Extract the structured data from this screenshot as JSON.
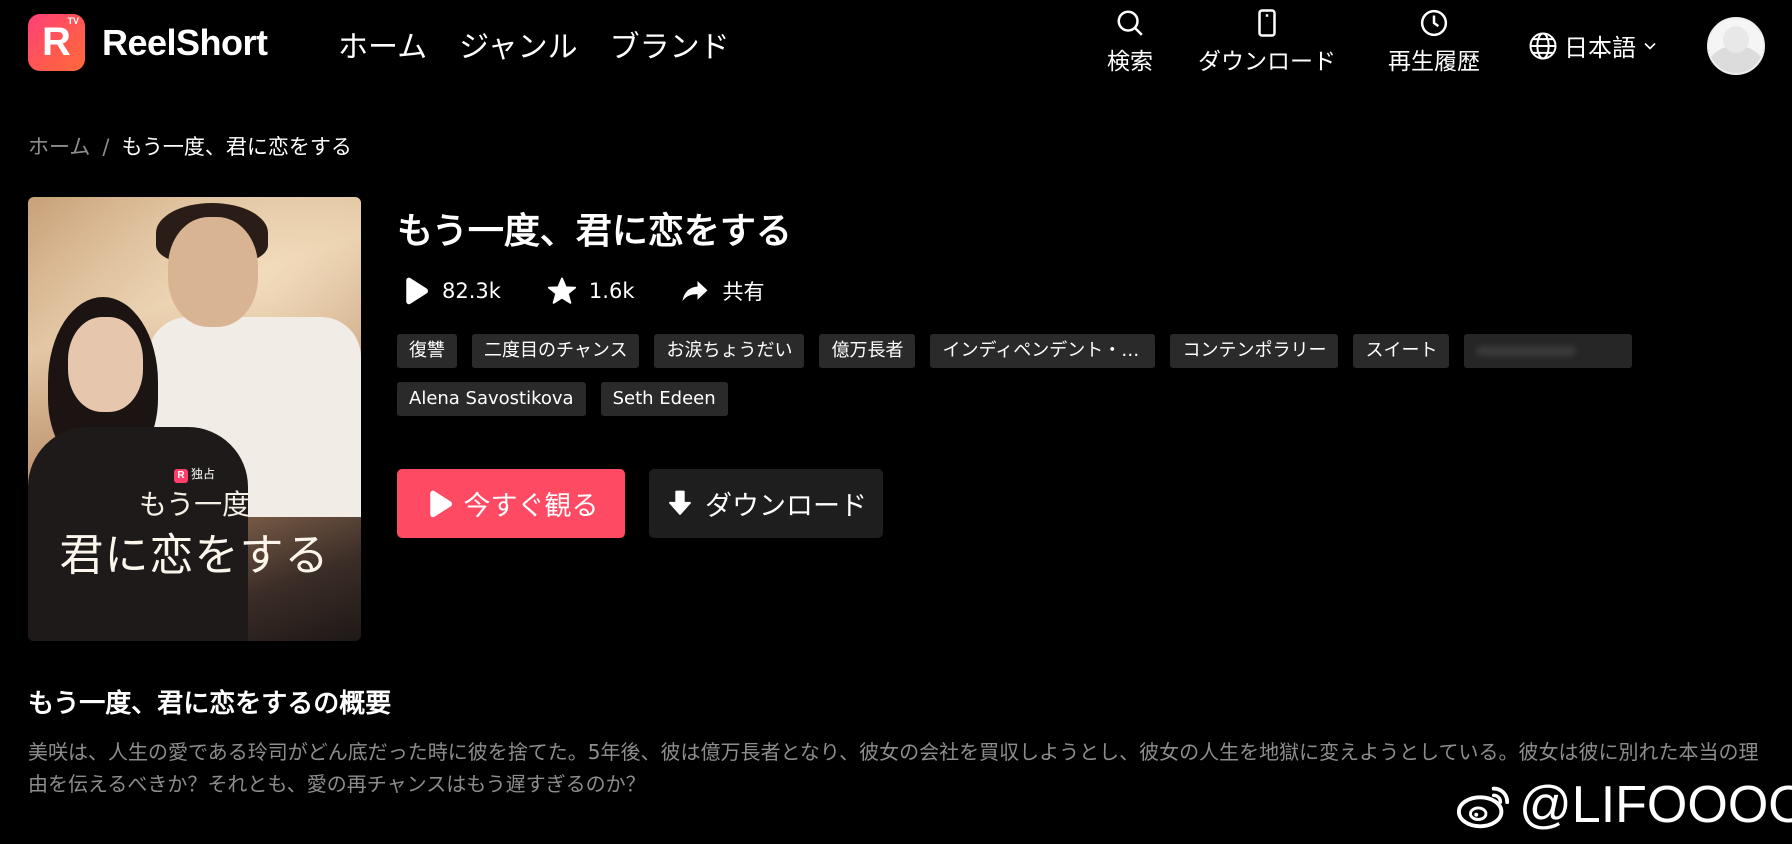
{
  "header": {
    "logo_text": "ReelShort",
    "logo_badge": "R",
    "logo_badge_tv": "TV",
    "nav": [
      "ホーム",
      "ジャンル",
      "ブランド"
    ],
    "search_label": "検索",
    "download_label": "ダウンロード",
    "history_label": "再生履歴",
    "language": "日本語"
  },
  "breadcrumb": {
    "home": "ホーム",
    "separator": "/",
    "current": "もう一度、君に恋をする"
  },
  "poster": {
    "badge_icon": "R",
    "badge": "独占",
    "line1": "もう一度",
    "line2": "君に恋をする"
  },
  "drama": {
    "title": "もう一度、君に恋をする",
    "plays": "82.3k",
    "favorites": "1.6k",
    "share_label": "共有",
    "tags": [
      "復讐",
      "二度目のチャンス",
      "お涙ちょうだい",
      "億万長者",
      "インディペンデント・ウーマン",
      "コンテンポラリー",
      "スイート"
    ],
    "actors": [
      "Alena Savostikova",
      "Seth Edeen"
    ],
    "watch_label": "今すぐ観る",
    "download_label": "ダウンロード"
  },
  "synopsis": {
    "title": "もう一度、君に恋をするの概要",
    "text": "美咲は、人生の愛である玲司がどん底だった時に彼を捨てた。5年後、彼は億万長者となり、彼女の会社を買収しようとし、彼女の人生を地獄に変えようとしている。彼女は彼に別れた本当の理由を伝えるべきか？それとも、愛の再チャンスはもう遅すぎるのか？"
  },
  "watermark": {
    "text": "@LIFOOOO",
    "icon": "weibo-icon"
  },
  "colors": {
    "accent": "#ff4a64",
    "background": "#000000",
    "tag_bg": "#2a2a2a",
    "muted_text": "#8d8d8d"
  }
}
